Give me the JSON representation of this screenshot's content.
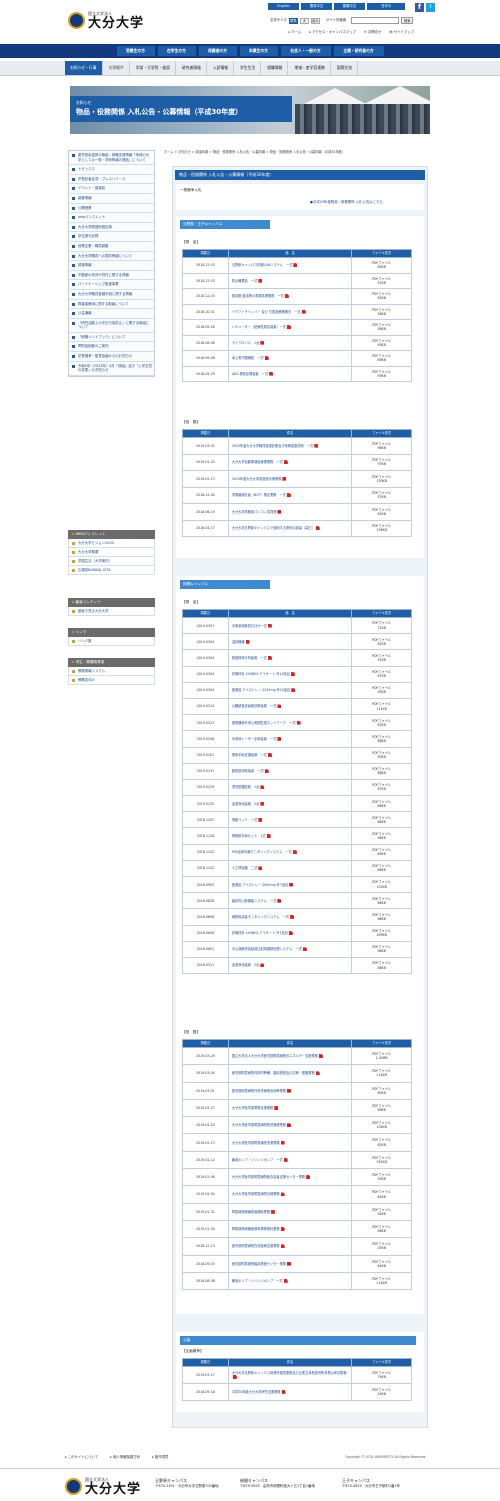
{
  "header": {
    "logo_sub": "国立大学法人",
    "logo_name": "大分大学",
    "lang": [
      "English",
      "簡体中文",
      "繁體中文",
      "한국어"
    ],
    "font_size_label": "文字サイズ",
    "font_sizes": [
      "標準",
      "大",
      "最大"
    ],
    "site_search_label": "サイト内検索",
    "search_button": "検索",
    "top_links": [
      "ホーム",
      "アクセス・キャンパスマップ",
      "お問合せ",
      "サイトマップ"
    ]
  },
  "main_nav": [
    "受験生の方",
    "在学生の方",
    "保護者の方",
    "卒業生の方",
    "社会人・一般の方",
    "企業・研究者の方"
  ],
  "sub_nav": [
    "お知らせ・行事",
    "大学紹介",
    "学部・大学院・施設",
    "研究者情報",
    "入試情報",
    "学生生活",
    "就職情報",
    "地域・産学官連携",
    "国際交流"
  ],
  "banner": {
    "small": "お知らせ",
    "title": "物品・役務関係 入札公告・公募情報（平成30年度）"
  },
  "breadcrumb": "ホーム > お知らせ > 調達情報 > 物品・役務関係 入札公告・公募情報 > 物品・役務関係 入札公告・公募情報（平成30年度）",
  "sidebar": {
    "items": [
      "産学官民連携の取組・就職支援情報「地域の大学としての一般・学術情報の発信」について",
      "トピックス",
      "学長記者会見・プレスリリース",
      "イベント・講演会",
      "募集情報",
      "公開授業",
      "webパンフレット",
      "大分大学関連財団記事",
      "学位授与記録",
      "就業企業・職員募集",
      "大分大学職員への表彰情報について",
      "調達情報",
      "不動産の売却や貸付に関する情報",
      "パートナーシップ推進事業",
      "大分大学職員各種手続に関する情報",
      "障害者雇用に関する取組について",
      "公益通報",
      "「研究活動上の不正行為防止」に関する取組について",
      "「就職ハンドブック」について",
      "寄附金制度のご案内",
      "学長選考・監督会議からのお知らせ",
      "令和5年（2023年）4月「改組」及び「入学定員の変更」のお知らせ"
    ],
    "pamphlet_head": "WEBパンフレット",
    "pamphlet": [
      "大分大学ビジョン2040",
      "大分大学概要",
      "学園生活（大学案内）",
      "広報誌BUNDAI-OITA"
    ],
    "video_head": "動画コンテンツ",
    "video": [
      "動画で見る大分大学"
    ],
    "link_head": "リンク",
    "link": [
      "リンク集"
    ],
    "staff_head": "学生・教職員専用",
    "staff": [
      "教務情報システム",
      "教職員向け"
    ]
  },
  "content": {
    "title": "物品・役務関係 入札公告・公募情報（平成30年度）",
    "section_general": "一般競争入札",
    "prev_link": "●平成29年度物品・役務関係 入札公告はこちら",
    "campus1": "旦野原・王子キャンパス",
    "goods": "【物　品】",
    "service": "【役　務】",
    "campus2": "挾間キャンパス",
    "campus3": "公募",
    "public_label": "【企画競争】",
    "col_date": "掲載日",
    "col_name": "品　名",
    "col_name2": "件名",
    "col_file": "ファイル形式",
    "pdf": "PDFファイル",
    "dan_goods": [
      [
        "2018-12-03",
        "旦野原キャンパス情報LANシステム　一式",
        "85KB"
      ],
      [
        "2018-12-03",
        "防災備蓄品　一式",
        "52KB"
      ],
      [
        "2018-12-03",
        "図書館 蔵書等の電算処理業務　一式",
        "82KB"
      ],
      [
        "2018-10-01",
        "ドラフトチャンバー 及び 付属設備等撤去　一式",
        "56KB"
      ],
      [
        "2018-09-26",
        "レオメーター（粘弾性測定装置）一式",
        "58KB"
      ],
      [
        "2018-06-06",
        "マイクロバス　1台",
        "90KB"
      ],
      [
        "2018-06-06",
        "卓上電子顕微鏡　一式",
        "89KB"
      ],
      [
        "2018-05-29",
        "ADS 薬液処理装置　一式",
        "59KB"
      ]
    ],
    "dan_service": [
      [
        "2019-03-01",
        "2019年度大分大学職員健康診断及び特殊健康診断　一式",
        "96KB"
      ],
      [
        "2019-02-20",
        "大分大学自動車運転管理業務　一式",
        "97KB"
      ],
      [
        "2019-02-13",
        "2019年度大分大学各施設清掃業務",
        "130KB"
      ],
      [
        "2018-12-04",
        "事業継続計画（BCP）策定業務　一式",
        "57KB"
      ],
      [
        "2018-06-19",
        "大分大学事務用パソコン賃貸借",
        "62KB"
      ],
      [
        "2018-04-17",
        "大分大学旦野原キャンパスで使用する電気の調達（高圧）",
        "136KB"
      ]
    ],
    "has_goods": [
      [
        "2019-0307",
        "手術室用無影灯ほか一式",
        "72KB"
      ],
      [
        "2019-0304",
        "温熱機器",
        "62KB"
      ],
      [
        "2019-0304",
        "検査検体分析装置　一式",
        "91KB"
      ],
      [
        "2019-0304",
        "診療材料 VIVINEX アイサート 外13品目",
        "87KB"
      ],
      [
        "2019-0304",
        "医薬品 アイロトレース240mg 外10品目",
        "95KB"
      ],
      [
        "2019-0214",
        "心臓超音波画像診断装置　一式",
        "111KB"
      ],
      [
        "2019-0213",
        "循環器科外来心電図監視ネットワーク　一式",
        "62KB"
      ],
      [
        "2019-0208",
        "半導体レーザー手術装置　一式",
        "88KB"
      ],
      [
        "2019-0201",
        "関節手術支援装置　一式",
        "90KB"
      ],
      [
        "2019-0131",
        "超音波診断装置　一式",
        "88KB"
      ],
      [
        "2019-0129",
        "漂流型腹腔鏡　1台",
        "87KB"
      ],
      [
        "2019-0125",
        "血液浄化装置　2台",
        "86KB"
      ],
      [
        "2018-1207",
        "電動ベッド　一式",
        "88KB"
      ],
      [
        "2018-1126",
        "関節鏡手術セット　1式",
        "96KB"
      ],
      [
        "2018-1122",
        "MRI全体情報モニタリングシステム　一式",
        "89KB"
      ],
      [
        "2018-1122",
        "人工呼吸器　二式",
        "86KB"
      ],
      [
        "2018-0903",
        "医薬品 アイロトレース600mg 外7品目",
        "101KB"
      ],
      [
        "2018-0828",
        "臨床的心肺機能システム　一式",
        "86KB"
      ],
      [
        "2018-0808",
        "病院用患者モニタリングシステム　一式",
        "88KB"
      ],
      [
        "2018-0608",
        "診療材料 VIVINEX アイサート 外7品目",
        "499KB"
      ],
      [
        "2018-0601",
        "中心静脈栄養製造注射用薬剤処理システム　一式",
        "98KB"
      ],
      [
        "2018-0511",
        "血液浄化装置　2台",
        "88KB"
      ]
    ],
    "has_service": [
      [
        "2019-03-29",
        "国立大学法人大分大学医学部附属病院省エネルギー支援業務",
        "1.34MB"
      ],
      [
        "2019-03-04",
        "医学部附属病院内院内警備、臨床検査及び清掃・運搬業務",
        "114KB"
      ],
      [
        "2019-03-01",
        "医学部附属病院外来診療費収納等業務",
        "60KB"
      ],
      [
        "2019-02-27",
        "大分大学医学部業務支援業務",
        "69KB"
      ],
      [
        "2019-02-20",
        "大分大学医学部附属病院物流管理業務",
        "104KB"
      ],
      [
        "2019-02-13",
        "大分大学医学部附属病院洗濯業務",
        "62KB"
      ],
      [
        "2019-02-12",
        "輸液ポンプ・シリンジポンプ　一式",
        "162KB"
      ],
      [
        "2019-02-06",
        "大分大学医学部附属病院総合患者支援センター業務",
        "55KB"
      ],
      [
        "2019-02-04",
        "大分大学医学部附属病院清掃業務",
        "64KB"
      ],
      [
        "2019-01-31",
        "附属病院病棟看護補助業務",
        "92KB"
      ],
      [
        "2019-01-30",
        "附属病院病棟医療事務等委託業務",
        "66KB"
      ],
      [
        "2018-12-13",
        "医学部附属病院在宅医療支援業務",
        "25KB"
      ],
      [
        "2018-09-03",
        "医学部附属病院臨床検査センター業務",
        "64KB"
      ],
      [
        "2018-08-08",
        "輸液ポンプ・シリンジポンプ　一式",
        "114KB"
      ]
    ],
    "public": [
      [
        "2019-03-27",
        "大分大学旦野原キャンパス保育所運営業務及び企業主導型保育所事業の申請業務",
        "79KB"
      ],
      [
        "2018-09-18",
        "平成30年度大分大学研究支援業務",
        "29KB"
      ]
    ]
  },
  "footer": {
    "links": [
      "このサイトについて",
      "個人情報保護方針",
      "動作環境"
    ],
    "copyright": "Copyright © OITA UNIVERSITY. All Rights Reserved.",
    "campuses": [
      {
        "name": "旦野原キャンパス",
        "addr": "〒870-1192　大分市大字旦野原700番地"
      },
      {
        "name": "挾間キャンパス",
        "addr": "〒879-5593　由布市挾間町医大ヶ丘1丁目1番地"
      },
      {
        "name": "王子キャンパス",
        "addr": "〒870-0819　大分市王子新町1番1号"
      }
    ]
  },
  "colors": {
    "navy": "#12397d",
    "blue": "#1e5ea6",
    "caption": "#3f89cf",
    "gold": "#d9a11b"
  }
}
